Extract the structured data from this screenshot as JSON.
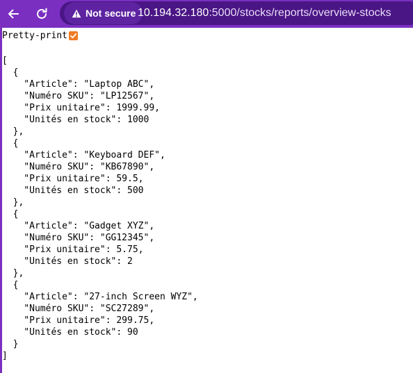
{
  "browser": {
    "security_label": "Not secure",
    "url_host": "10.194.32.180",
    "url_path": ":5000/stocks/reports/overview-stocks"
  },
  "page": {
    "pretty_print_label": "Pretty-print",
    "pretty_print_checked": true,
    "json": {
      "open_bracket": "[",
      "close_bracket": "]",
      "items": [
        {
          "article_line": "    \"Article\": \"Laptop ABC\",",
          "sku_line": "    \"Numéro SKU\": \"LP12567\",",
          "price_line": "    \"Prix unitaire\": 1999.99,",
          "stock_line": "    \"Unités en stock\": 1000"
        },
        {
          "article_line": "    \"Article\": \"Keyboard DEF\",",
          "sku_line": "    \"Numéro SKU\": \"KB67890\",",
          "price_line": "    \"Prix unitaire\": 59.5,",
          "stock_line": "    \"Unités en stock\": 500"
        },
        {
          "article_line": "    \"Article\": \"Gadget XYZ\",",
          "sku_line": "    \"Numéro SKU\": \"GG12345\",",
          "price_line": "    \"Prix unitaire\": 5.75,",
          "stock_line": "    \"Unités en stock\": 2"
        },
        {
          "article_line": "    \"Article\": \"27-inch Screen WYZ\",",
          "sku_line": "    \"Numéro SKU\": \"SC27289\",",
          "price_line": "    \"Prix unitaire\": 299.75,",
          "stock_line": "    \"Unités en stock\": 90"
        }
      ],
      "object_open": "  {",
      "object_close": "  },",
      "object_close_last": "  }"
    }
  }
}
